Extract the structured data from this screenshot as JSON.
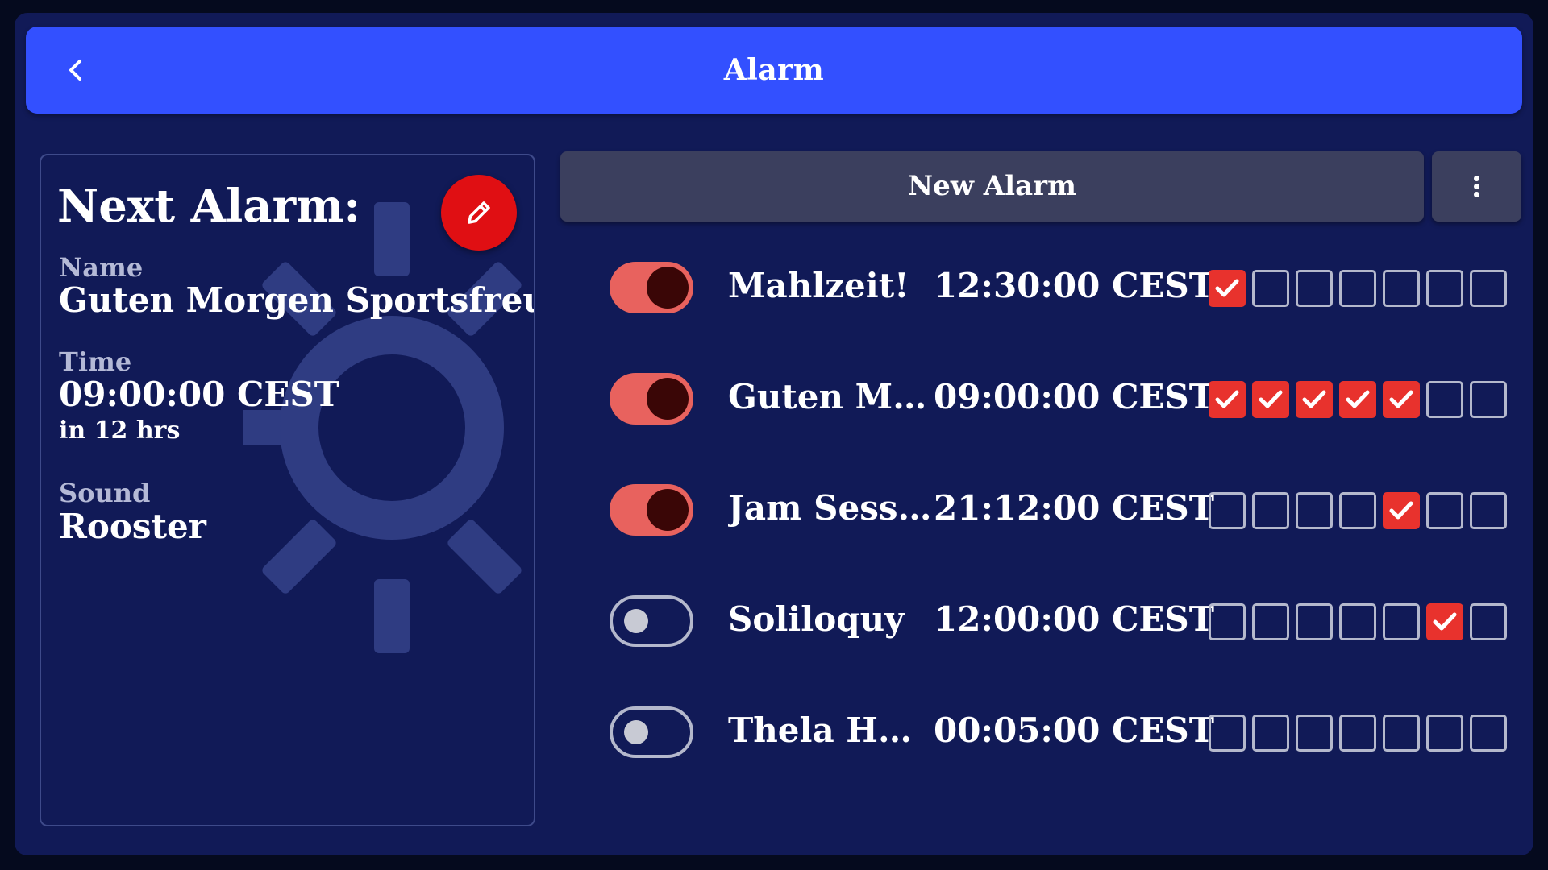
{
  "header": {
    "title": "Alarm",
    "back_icon": "chevron-left-icon"
  },
  "next_alarm": {
    "heading": "Next Alarm:",
    "edit_icon": "pencil-icon",
    "background_icon": "sun-icon",
    "name_label": "Name",
    "name_value": "Guten Morgen Sportsfreund!",
    "time_label": "Time",
    "time_value": "09:00:00 CEST",
    "time_relative": "in 12 hrs",
    "sound_label": "Sound",
    "sound_value": "Rooster"
  },
  "toolbar": {
    "new_alarm_label": "New Alarm",
    "menu_icon": "more-vertical-icon"
  },
  "colors": {
    "header": "#3350ff",
    "background": "#111a57",
    "toggle_on": "#e8625e",
    "check": "#e8322d",
    "edit_button": "#e00f13"
  },
  "alarms": [
    {
      "name": "Mahlzeit!",
      "time": "12:30:00 CEST",
      "enabled": true,
      "days": [
        true,
        false,
        false,
        false,
        false,
        false,
        false
      ]
    },
    {
      "name": "Guten Morge...",
      "time": "09:00:00 CEST",
      "enabled": true,
      "days": [
        true,
        true,
        true,
        true,
        true,
        false,
        false
      ]
    },
    {
      "name": "Jam Session",
      "time": "21:12:00 CEST",
      "enabled": true,
      "days": [
        false,
        false,
        false,
        false,
        true,
        false,
        false
      ]
    },
    {
      "name": "Soliloquy",
      "time": "12:00:00 CEST",
      "enabled": false,
      "days": [
        false,
        false,
        false,
        false,
        false,
        true,
        false
      ]
    },
    {
      "name": "Thela Hun Gi...",
      "time": "00:05:00 CEST",
      "enabled": false,
      "days": [
        false,
        false,
        false,
        false,
        false,
        false,
        false
      ]
    }
  ]
}
